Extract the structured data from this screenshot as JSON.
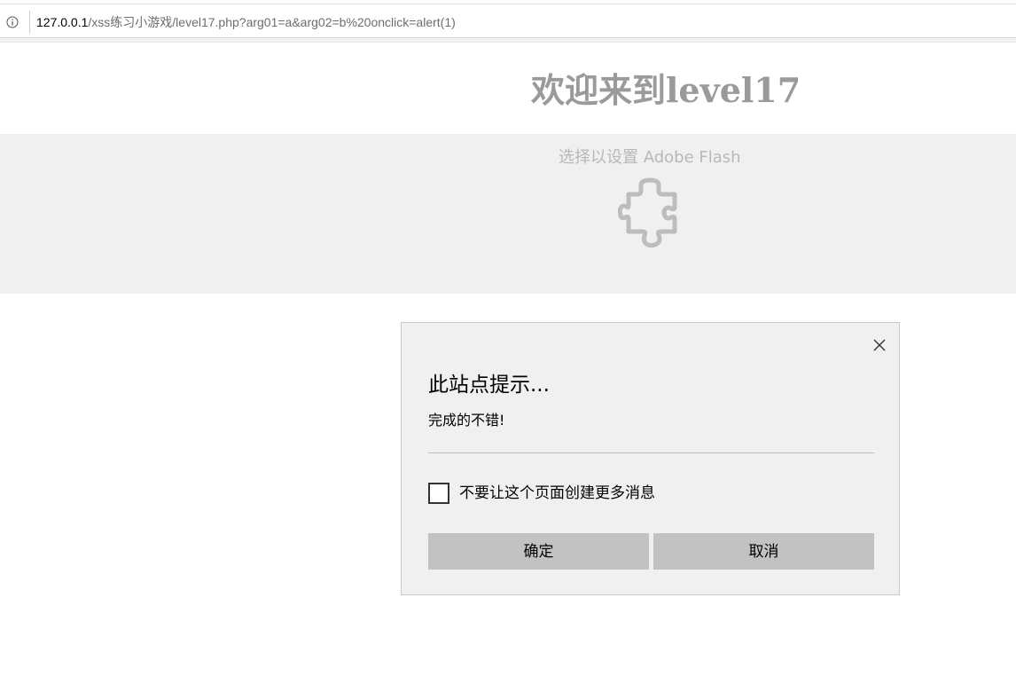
{
  "browser": {
    "url_host": "127.0.0.1",
    "url_path": "/xss练习小游戏/level17.php?arg01=a&arg02=b%20onclick=alert(1)",
    "info_icon": "info-icon"
  },
  "page": {
    "title": "欢迎来到level17",
    "flash_prompt": "选择以设置 Adobe Flash",
    "plugin_icon": "puzzle-piece-icon"
  },
  "dialog": {
    "title": "此站点提示...",
    "message": "完成的不错!",
    "checkbox_label": "不要让这个页面创建更多消息",
    "checkbox_checked": false,
    "ok_label": "确定",
    "cancel_label": "取消",
    "close_icon": "close-icon"
  }
}
